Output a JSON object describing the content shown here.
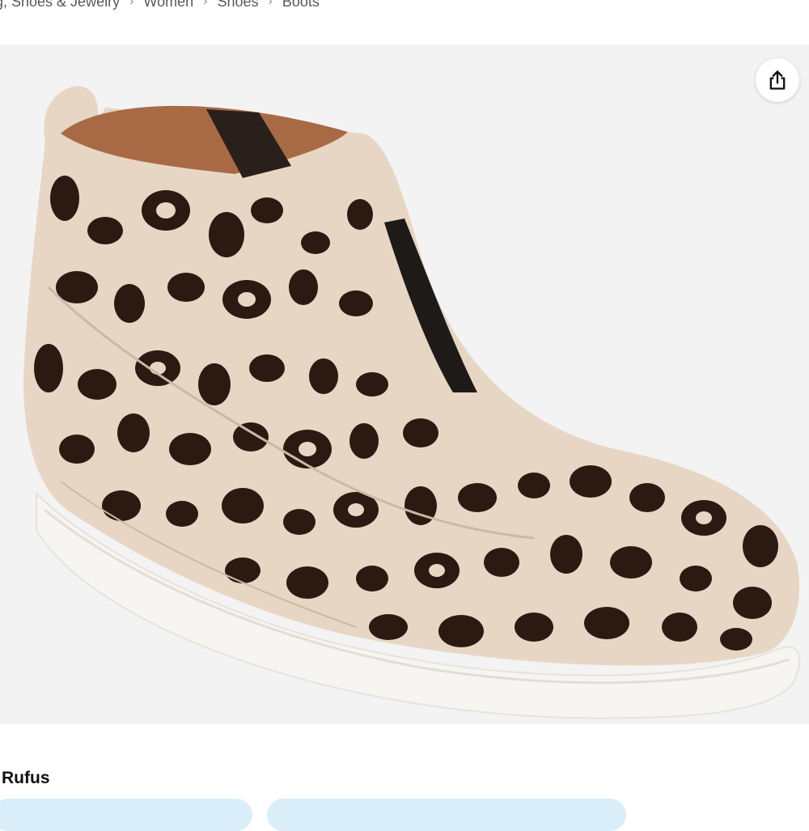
{
  "breadcrumb": {
    "items": [
      "g, Shoes & Jewelry",
      "Women",
      "Shoes",
      "Boots"
    ],
    "separator": "›"
  },
  "product": {
    "brand": "Rufus",
    "image_alt": "leopard print wedge sneaker bootie"
  },
  "icons": {
    "share": "share-icon"
  },
  "colors": {
    "hero_background": "#f3f3f3",
    "pill_background": "#d9eef8",
    "leopard_base": "#e8d6c4",
    "leopard_spot": "#2b1a12",
    "sole": "#f7f5f2"
  }
}
